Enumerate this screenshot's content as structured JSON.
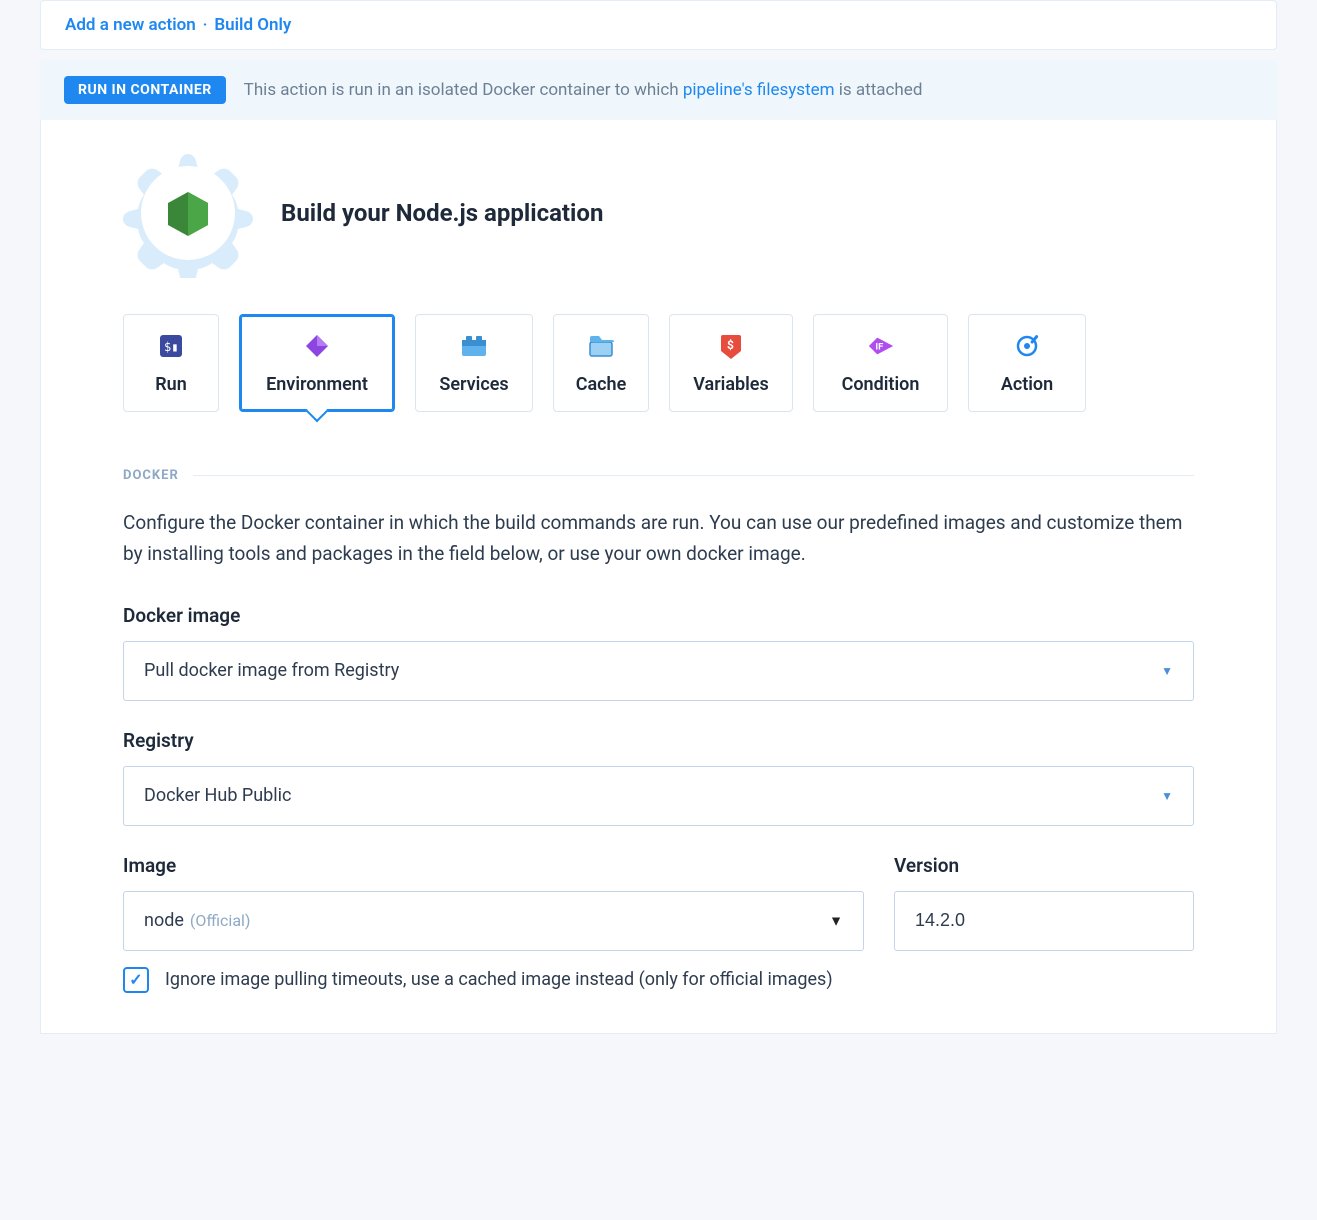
{
  "breadcrumb": {
    "link1": "Add a new action",
    "link2": "Build Only"
  },
  "banner": {
    "badge": "RUN IN CONTAINER",
    "text_before": "This action is run in an isolated Docker container to which ",
    "link": "pipeline's filesystem",
    "text_after": " is attached"
  },
  "heading": "Build your Node.js application",
  "tabs": [
    {
      "label": "Run",
      "icon": "run-icon",
      "active": false
    },
    {
      "label": "Environment",
      "icon": "environment-icon",
      "active": true
    },
    {
      "label": "Services",
      "icon": "services-icon",
      "active": false
    },
    {
      "label": "Cache",
      "icon": "cache-icon",
      "active": false
    },
    {
      "label": "Variables",
      "icon": "variables-icon",
      "active": false
    },
    {
      "label": "Condition",
      "icon": "condition-icon",
      "active": false
    },
    {
      "label": "Action",
      "icon": "action-icon",
      "active": false
    }
  ],
  "section": {
    "label": "DOCKER",
    "description": "Configure the Docker container in which the build commands are run. You can use our predefined images and customize them by installing tools and packages in the field below, or use your own docker image."
  },
  "fields": {
    "docker_image": {
      "label": "Docker image",
      "value": "Pull docker image from Registry"
    },
    "registry": {
      "label": "Registry",
      "value": "Docker Hub Public"
    },
    "image": {
      "label": "Image",
      "value": "node",
      "suffix": "(Official)"
    },
    "version": {
      "label": "Version",
      "value": "14.2.0"
    },
    "ignore_timeouts": {
      "checked": true,
      "label": "Ignore image pulling timeouts, use a cached image instead (only for official images)"
    }
  }
}
